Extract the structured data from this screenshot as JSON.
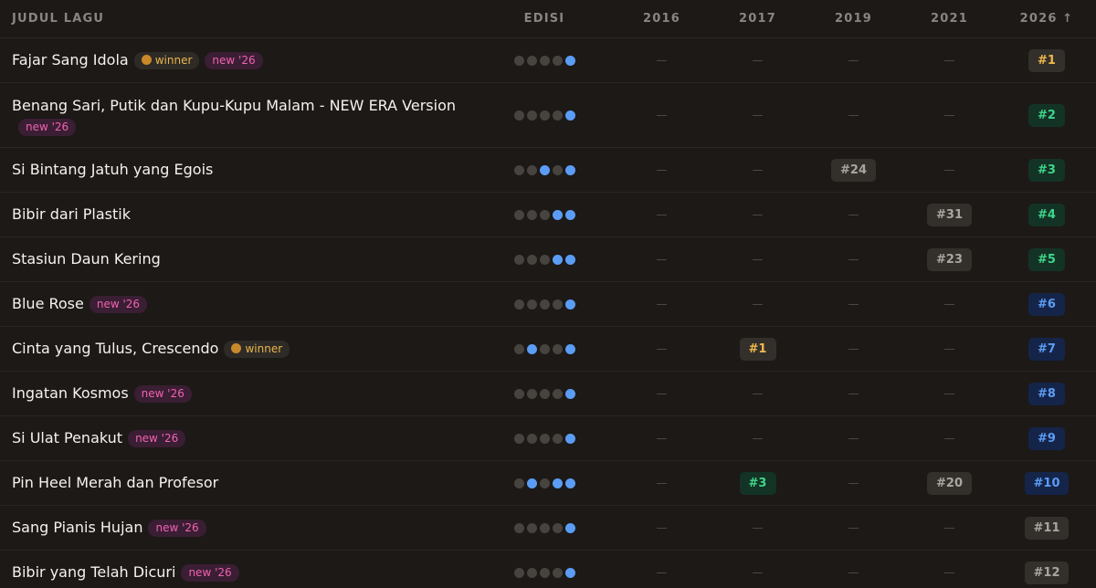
{
  "header": {
    "title_col": "JUDUL LAGU",
    "edisi_col": "EDISI",
    "years": [
      "2016",
      "2017",
      "2019",
      "2021",
      "2026 ↑"
    ]
  },
  "badges": {
    "winner": "winner",
    "new": "new '26"
  },
  "colors": {
    "dot_on": "#5b9df5",
    "gold": "#f0b94a",
    "green": "#3fd68a",
    "blue": "#5b9df5",
    "new_pink": "#f062b2"
  },
  "rows": [
    {
      "title": "Fajar Sang Idola",
      "winner": true,
      "new": true,
      "dots": [
        0,
        0,
        0,
        0,
        1
      ],
      "ranks": [
        null,
        null,
        null,
        null,
        "#1"
      ],
      "styles": [
        null,
        null,
        null,
        null,
        "gold"
      ]
    },
    {
      "title": "Benang Sari, Putik dan Kupu-Kupu Malam - NEW ERA Version",
      "winner": false,
      "new": true,
      "tall": true,
      "dots": [
        0,
        0,
        0,
        0,
        1
      ],
      "ranks": [
        null,
        null,
        null,
        null,
        "#2"
      ],
      "styles": [
        null,
        null,
        null,
        null,
        "green"
      ]
    },
    {
      "title": "Si Bintang Jatuh yang Egois",
      "winner": false,
      "new": false,
      "dots": [
        0,
        0,
        1,
        0,
        1
      ],
      "ranks": [
        null,
        null,
        "#24",
        null,
        "#3"
      ],
      "styles": [
        null,
        null,
        "gray",
        null,
        "green"
      ]
    },
    {
      "title": "Bibir dari Plastik",
      "winner": false,
      "new": false,
      "dots": [
        0,
        0,
        0,
        1,
        1
      ],
      "ranks": [
        null,
        null,
        null,
        "#31",
        "#4"
      ],
      "styles": [
        null,
        null,
        null,
        "gray",
        "green"
      ]
    },
    {
      "title": "Stasiun Daun Kering",
      "winner": false,
      "new": false,
      "dots": [
        0,
        0,
        0,
        1,
        1
      ],
      "ranks": [
        null,
        null,
        null,
        "#23",
        "#5"
      ],
      "styles": [
        null,
        null,
        null,
        "gray",
        "green"
      ]
    },
    {
      "title": "Blue Rose",
      "winner": false,
      "new": true,
      "dots": [
        0,
        0,
        0,
        0,
        1
      ],
      "ranks": [
        null,
        null,
        null,
        null,
        "#6"
      ],
      "styles": [
        null,
        null,
        null,
        null,
        "blue"
      ]
    },
    {
      "title": "Cinta yang Tulus, Crescendo",
      "winner": true,
      "new": false,
      "dots": [
        0,
        1,
        0,
        0,
        1
      ],
      "ranks": [
        null,
        "#1",
        null,
        null,
        "#7"
      ],
      "styles": [
        null,
        "gold",
        null,
        null,
        "blue"
      ]
    },
    {
      "title": "Ingatan Kosmos",
      "winner": false,
      "new": true,
      "dots": [
        0,
        0,
        0,
        0,
        1
      ],
      "ranks": [
        null,
        null,
        null,
        null,
        "#8"
      ],
      "styles": [
        null,
        null,
        null,
        null,
        "blue"
      ]
    },
    {
      "title": "Si Ulat Penakut",
      "winner": false,
      "new": true,
      "dots": [
        0,
        0,
        0,
        0,
        1
      ],
      "ranks": [
        null,
        null,
        null,
        null,
        "#9"
      ],
      "styles": [
        null,
        null,
        null,
        null,
        "blue"
      ]
    },
    {
      "title": "Pin Heel Merah dan Profesor",
      "winner": false,
      "new": false,
      "dots": [
        0,
        1,
        0,
        1,
        1
      ],
      "ranks": [
        null,
        "#3",
        null,
        "#20",
        "#10"
      ],
      "styles": [
        null,
        "green",
        null,
        "gray",
        "blue"
      ]
    },
    {
      "title": "Sang Pianis Hujan",
      "winner": false,
      "new": true,
      "dots": [
        0,
        0,
        0,
        0,
        1
      ],
      "ranks": [
        null,
        null,
        null,
        null,
        "#11"
      ],
      "styles": [
        null,
        null,
        null,
        null,
        "gray"
      ]
    },
    {
      "title": "Bibir yang Telah Dicuri",
      "winner": false,
      "new": true,
      "dots": [
        0,
        0,
        0,
        0,
        1
      ],
      "ranks": [
        null,
        null,
        null,
        null,
        "#12"
      ],
      "styles": [
        null,
        null,
        null,
        null,
        "gray"
      ]
    }
  ]
}
